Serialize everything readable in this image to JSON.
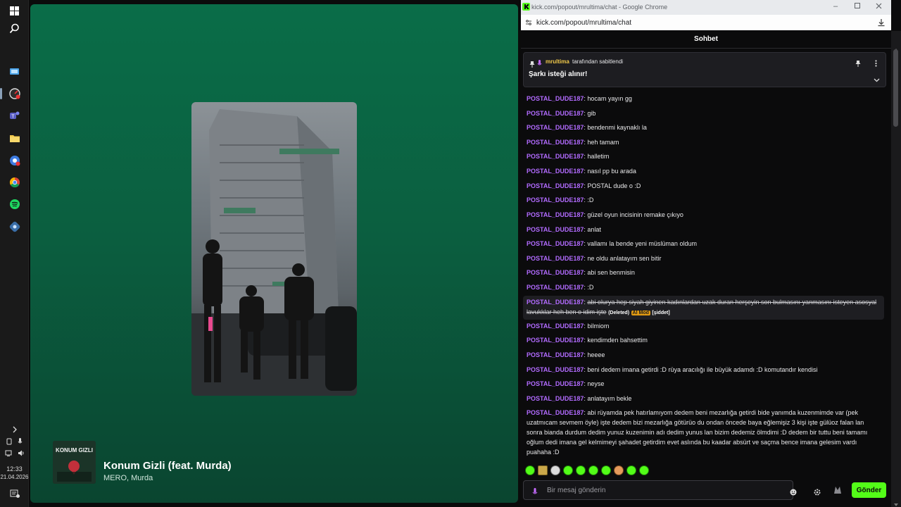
{
  "taskbar": {
    "icons": [
      "windows-icon",
      "search-icon",
      "explorer-app-icon",
      "speed-app-icon",
      "teams-icon",
      "folder-icon",
      "chrome-profile-icon",
      "chrome-icon",
      "spotify-icon",
      "vpn-icon"
    ],
    "clock_time": "12:33",
    "clock_date": "21.04.2026",
    "tray_icons": [
      "chevron-icon",
      "mic-icon",
      "wifi-icon",
      "volume-icon"
    ]
  },
  "spotify": {
    "track_title": "Konum Gizli (feat. Murda)",
    "artists": "MERO, Murda",
    "album_text": "KONUM GIZLI",
    "colors": {
      "bg_top": "#0a6d48",
      "bg_bottom": "#0a4530"
    }
  },
  "browser": {
    "window_title": "kick.com/popout/mrultima/chat - Google Chrome",
    "url": "kick.com/popout/mrultima/chat"
  },
  "chat": {
    "header": "Sohbet",
    "pinned": {
      "by_user": "mrultima",
      "by_suffix": "tarafından sabitlendi",
      "text": "Şarkı isteği alınır!"
    },
    "messages": [
      {
        "user": "POSTAL_DUDE187",
        "text": "hocam yayın gg"
      },
      {
        "user": "POSTAL_DUDE187",
        "text": "gib"
      },
      {
        "user": "POSTAL_DUDE187",
        "text": "bendenmi kaynaklı la"
      },
      {
        "user": "POSTAL_DUDE187",
        "text": "heh tamam"
      },
      {
        "user": "POSTAL_DUDE187",
        "text": "halletim"
      },
      {
        "user": "POSTAL_DUDE187",
        "text": "nasıl pp bu arada"
      },
      {
        "user": "POSTAL_DUDE187",
        "text": "POSTAL dude o :D"
      },
      {
        "user": "POSTAL_DUDE187",
        "text": ":D"
      },
      {
        "user": "POSTAL_DUDE187",
        "text": "güzel oyun incisinin remake çıkıyo"
      },
      {
        "user": "POSTAL_DUDE187",
        "text": "anlat"
      },
      {
        "user": "POSTAL_DUDE187",
        "text": "vallamı la bende yeni müslüman oldum"
      },
      {
        "user": "POSTAL_DUDE187",
        "text": "ne oldu anlatayım sen bitir"
      },
      {
        "user": "POSTAL_DUDE187",
        "text": "abi sen benmisin"
      },
      {
        "user": "POSTAL_DUDE187",
        "text": ":D"
      },
      {
        "user": "POSTAL_DUDE187",
        "text": "abi olurya hep siyah giyinen kadınlardan uzak duran herşeyin son bulmasını yanmasını isteyen asosyal lavukklar heh ben o idim işte",
        "deleted": true,
        "deleted_label": "(Deleted)",
        "mod_label": "AI Mod",
        "reason": "[şiddet]"
      },
      {
        "user": "POSTAL_DUDE187",
        "text": "bilmiom"
      },
      {
        "user": "POSTAL_DUDE187",
        "text": "kendimden bahsettim"
      },
      {
        "user": "POSTAL_DUDE187",
        "text": "heeee"
      },
      {
        "user": "POSTAL_DUDE187",
        "text": "beni dedem imana getirdi :D rüya aracılığı ile büyük adamdı :D komutandır kendisi"
      },
      {
        "user": "POSTAL_DUDE187",
        "text": "neyse"
      },
      {
        "user": "POSTAL_DUDE187",
        "text": "anlatayım bekle"
      },
      {
        "user": "POSTAL_DUDE187",
        "text": "abi rüyamda pek hatırlamıyom dedem beni mezarlığa getirdi bide yanımda kuzenmimde var (pek uzatmıcam sevmem öyle) işte dedem bizi mezarlığa götürüo du ondan öncede baya eğlemişiz 3 kişi işte gülüoz falan lan sonra bianda durdum dedim yunuz kuzenimin adı dedim yunus lan bizim dedemiz ölmdimi :D dedem bir tuttu beni tamamı oğlum dedi imana gel kelmimeyi şahadet getirdim evet aslında bu kaadar absürt ve saçma bence imana gelesim vardı puahaha :D"
      }
    ],
    "input_placeholder": "Bir mesaj gönderin",
    "send_label": "Gönder",
    "accent": "#53fc18",
    "username_color": "#b26bff"
  }
}
